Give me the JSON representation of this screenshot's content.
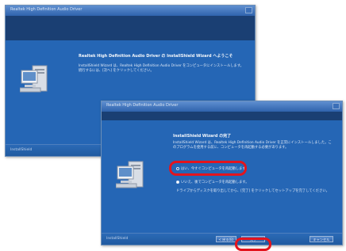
{
  "back_window": {
    "title": "Realtek High Definition Audio Driver",
    "heading": "Realtek High Definition Audio Driver の InstallShield Wizard へようこそ",
    "body": "InstallShield Wizard は、Realtek High Definition Audio Driver をコンピュータにインストールします。続行するには、[次へ] をクリックしてください。",
    "footer_label": "InstallShield"
  },
  "front_window": {
    "title": "Realtek High Definition Audio Driver",
    "heading": "InstallShield Wizard の完了",
    "body": "InstallShield Wizard は、Realtek High Definition Audio Driver を正常にインストールしました。このプログラムを使用する前に、コンピュータを再起動する必要があります。",
    "option_restart_now": "はい、今すぐコンピュータを再起動します。",
    "option_restart_later": "いいえ、後でコンピュータを再起動します。",
    "instruction": "ドライブからディスクを取り出してから、[完了] をクリックしてセットアップを完了してください。",
    "footer_label": "InstallShield",
    "back_button": "< 戻る(B)",
    "finish_button": "完了",
    "cancel_button": "キャンセル"
  },
  "highlight_color": "#e3141d"
}
